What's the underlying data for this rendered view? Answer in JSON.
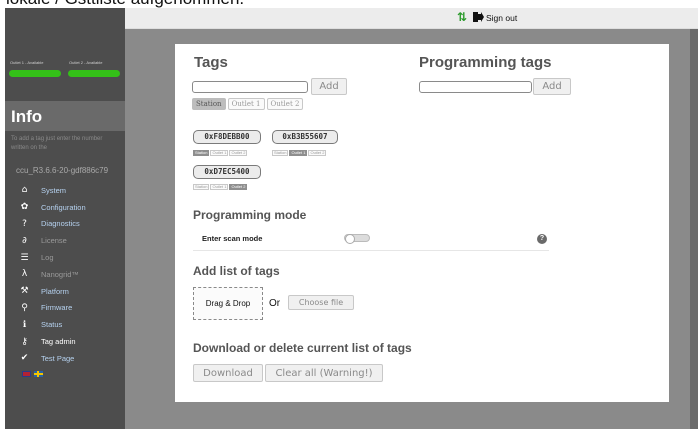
{
  "caption": "lokale / Gsttliste aufgenommen.",
  "sidebar": {
    "outlet1_label": "Outlet 1 - Available",
    "outlet2_label": "Outlet 2 - Available",
    "outlet_color": "#34c018",
    "info_title": "Info",
    "info_hint": "To add a tag just enter the number written on the",
    "version": "ccu_R3.6.6-20-gdf886c79",
    "nav": [
      {
        "label": "System",
        "icon": "home-icon",
        "glyph": "⌂",
        "state": "normal"
      },
      {
        "label": "Configuration",
        "icon": "gear-icon",
        "glyph": "✿",
        "state": "normal"
      },
      {
        "label": "Diagnostics",
        "icon": "question-icon",
        "glyph": "?",
        "state": "normal"
      },
      {
        "label": "License",
        "icon": "lock-icon",
        "glyph": "∂",
        "state": "dim"
      },
      {
        "label": "Log",
        "icon": "list-icon",
        "glyph": "☰",
        "state": "dim"
      },
      {
        "label": "Nanogrid™",
        "icon": "nanogrid-icon",
        "glyph": "λ",
        "state": "dim"
      },
      {
        "label": "Platform",
        "icon": "wrench-icon",
        "glyph": "⚒",
        "state": "normal"
      },
      {
        "label": "Firmware",
        "icon": "firmware-icon",
        "glyph": "⚲",
        "state": "normal"
      },
      {
        "label": "Status",
        "icon": "info-icon",
        "glyph": "ℹ",
        "state": "normal"
      },
      {
        "label": "Tag admin",
        "icon": "key-icon",
        "glyph": "⚷",
        "state": "active"
      },
      {
        "label": "Test Page",
        "icon": "check-icon",
        "glyph": "✔",
        "state": "normal"
      }
    ]
  },
  "topbar": {
    "signout_label": "Sign out",
    "sort_color": "#2a9a2a"
  },
  "tags": {
    "title": "Tags",
    "add_label": "Add",
    "outlet_tabs": [
      "Station",
      "Outlet 1",
      "Outlet 2"
    ],
    "chips": [
      {
        "id": "0xF8DEBB00",
        "selected": "Station"
      },
      {
        "id": "0xB3B55607",
        "selected": "Outlet 1"
      },
      {
        "id": "0xD7EC5400",
        "selected": "Outlet 2"
      }
    ],
    "mini_labels": [
      "Station",
      "Outlet 1",
      "Outlet 2"
    ]
  },
  "programming_tags": {
    "title": "Programming tags",
    "add_label": "Add"
  },
  "programming_mode": {
    "title": "Programming mode",
    "scan_label": "Enter scan mode",
    "help_glyph": "?"
  },
  "add_list": {
    "title": "Add list of tags",
    "drop_label": "Drag & Drop",
    "or_label": "Or",
    "choose_label": "Choose file"
  },
  "download": {
    "title": "Download or delete current list of tags",
    "download_label": "Download",
    "clear_label": "Clear all (Warning!)"
  }
}
